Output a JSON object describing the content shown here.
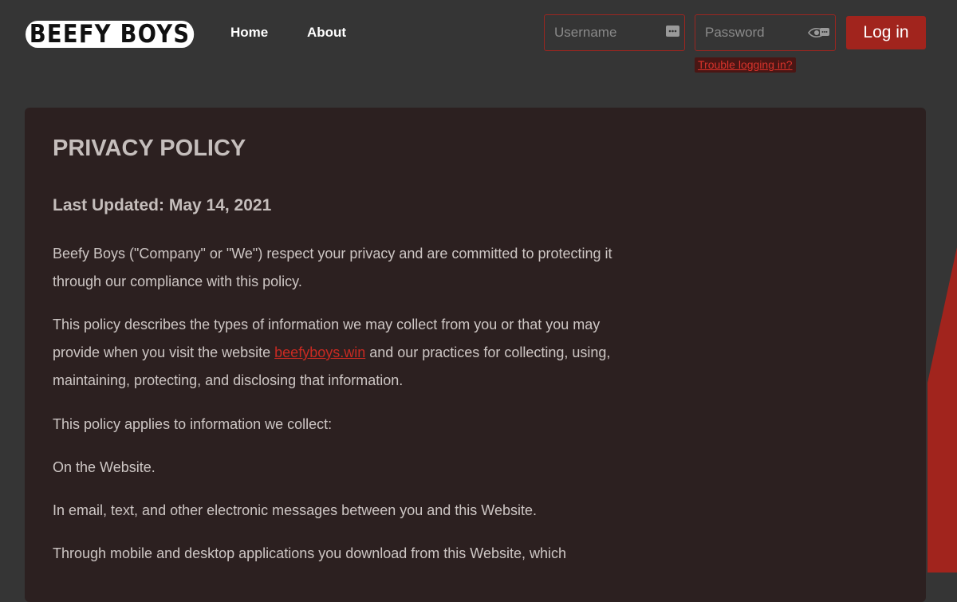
{
  "brand": {
    "logo_text": "BEEFY BOYS"
  },
  "nav": {
    "home": "Home",
    "about": "About"
  },
  "login": {
    "username_placeholder": "Username",
    "password_placeholder": "Password",
    "button_label": "Log in",
    "trouble_link": "Trouble logging in?"
  },
  "policy": {
    "title": "PRIVACY POLICY",
    "last_updated": "Last Updated: May 14, 2021",
    "p1": "Beefy Boys (\"Company\" or \"We\") respect your privacy and are committed to protecting it through our compliance with this policy.",
    "p2_before": "This policy describes the types of information we may collect from you or that you may provide when you visit the website ",
    "p2_link": "beefyboys.win",
    "p2_after": " and our practices for collecting, using, maintaining, protecting, and disclosing that information.",
    "p3": "This policy applies to information we collect:",
    "p4": "On the Website.",
    "p5": "In email, text, and other electronic messages between you and this Website.",
    "p6": "Through mobile and desktop applications you download from this Website, which"
  },
  "colors": {
    "accent": "#a1241d",
    "link": "#c92a22",
    "page_bg": "#353535",
    "card_bg": "#2c2020"
  }
}
